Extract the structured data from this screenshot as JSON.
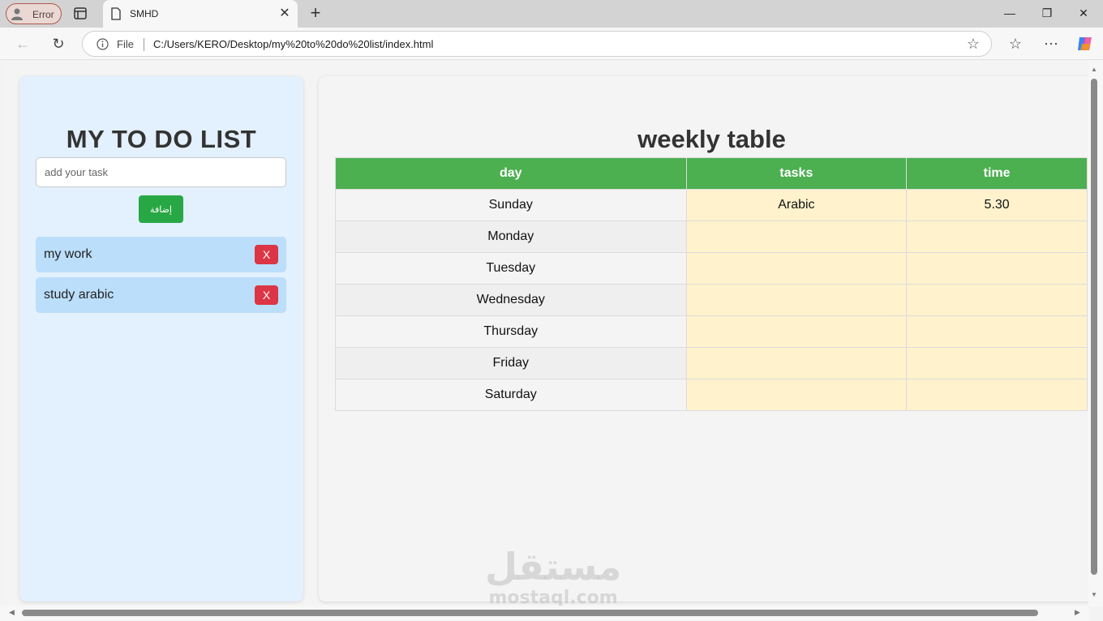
{
  "browser": {
    "profile_label": "Error",
    "tab_title": "SMHD",
    "address_prefix": "File",
    "url": "C:/Users/KERO/Desktop/my%20to%20do%20list/index.html"
  },
  "sidebar": {
    "title": "MY TO DO LIST",
    "input_placeholder": "add your task",
    "add_button_label": "إضافة",
    "delete_label": "X",
    "items": [
      {
        "label": "my work"
      },
      {
        "label": "study arabic"
      }
    ]
  },
  "main": {
    "title": "weekly table",
    "columns": [
      "day",
      "tasks",
      "time"
    ],
    "rows": [
      {
        "day": "Sunday",
        "task": "Arabic",
        "time": "5.30"
      },
      {
        "day": "Monday",
        "task": "",
        "time": ""
      },
      {
        "day": "Tuesday",
        "task": "",
        "time": ""
      },
      {
        "day": "Wednesday",
        "task": "",
        "time": ""
      },
      {
        "day": "Thursday",
        "task": "",
        "time": ""
      },
      {
        "day": "Friday",
        "task": "",
        "time": ""
      },
      {
        "day": "Saturday",
        "task": "",
        "time": ""
      }
    ]
  },
  "watermark": {
    "arabic": "مستقل",
    "latin": "mostaql.com"
  },
  "colors": {
    "header_green": "#4caf50",
    "add_button_green": "#28a745",
    "delete_red": "#dc3545",
    "task_item_blue": "#bbdefa",
    "sidebar_bg": "#e3f0fd",
    "cell_yellow": "#fff2cc"
  }
}
